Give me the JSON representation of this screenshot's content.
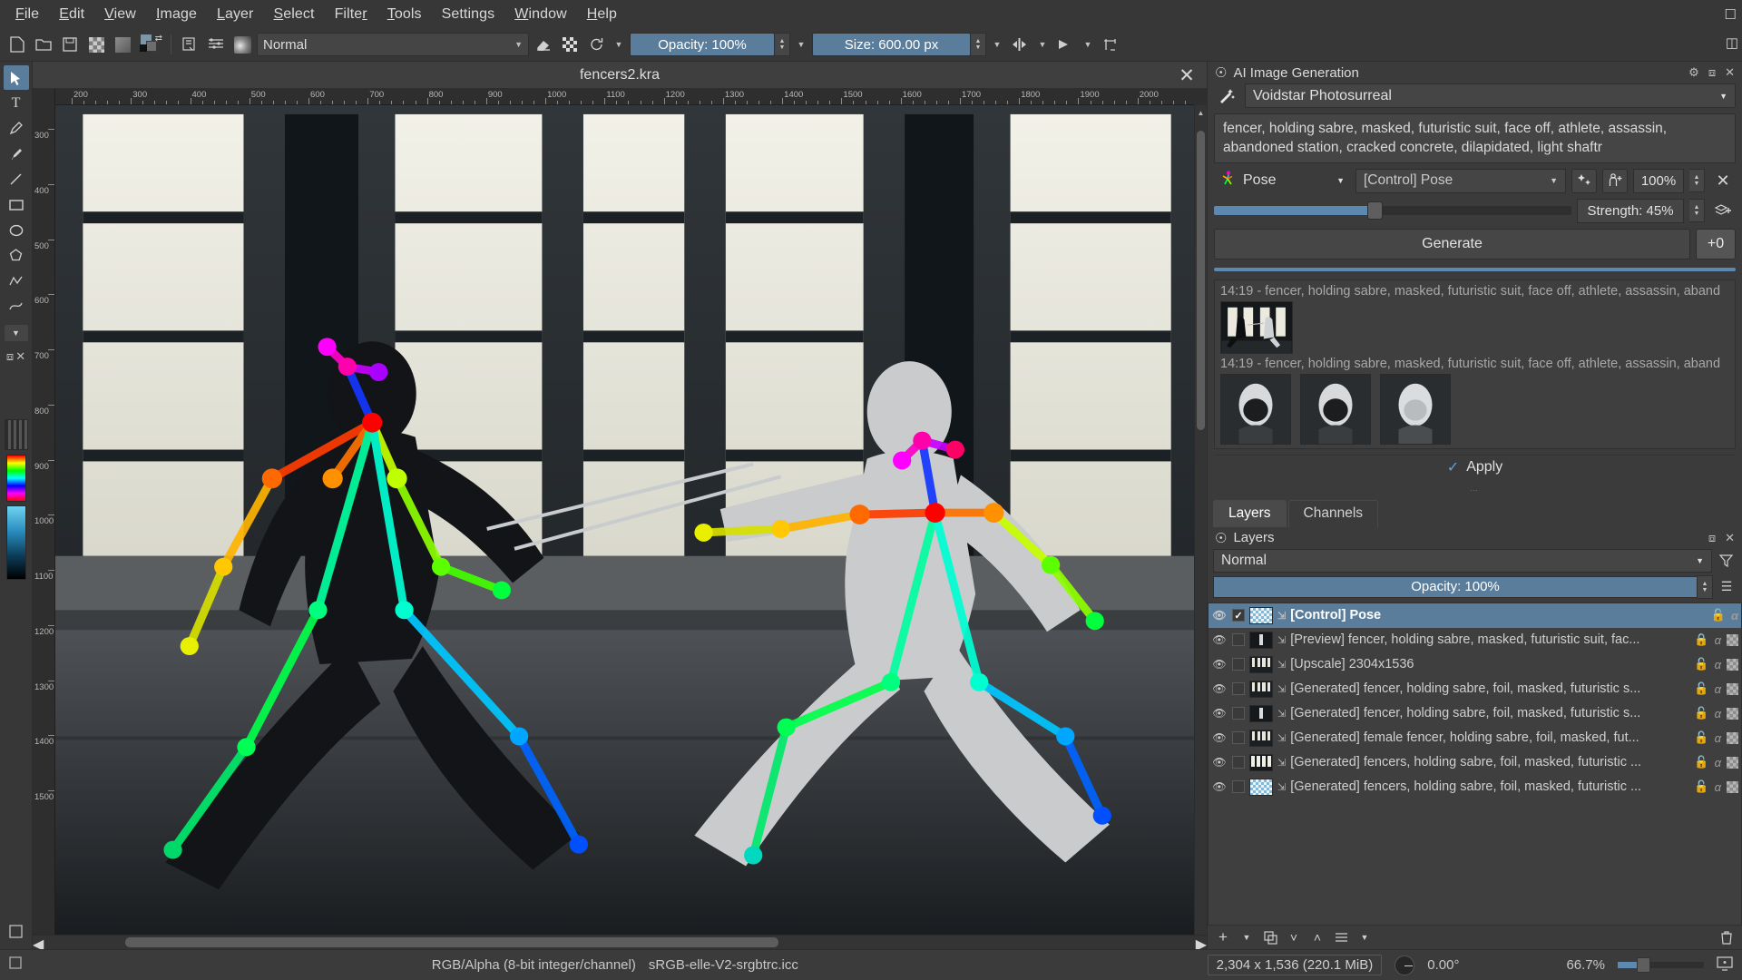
{
  "app": {
    "title": "fencers2.kra"
  },
  "menubar": {
    "items": [
      {
        "label": "File"
      },
      {
        "label": "Edit"
      },
      {
        "label": "View"
      },
      {
        "label": "Image"
      },
      {
        "label": "Layer"
      },
      {
        "label": "Select"
      },
      {
        "label": "Filter"
      },
      {
        "label": "Tools"
      },
      {
        "label": "Settings"
      },
      {
        "label": "Window"
      },
      {
        "label": "Help"
      }
    ]
  },
  "toolbar": {
    "blend_mode": "Normal",
    "opacity_label": "Opacity: 100%",
    "size_label": "Size: 600.00 px",
    "icons": [
      "new-document-icon",
      "open-document-icon",
      "save-icon",
      "transparency-checker-icon",
      "gradient-swatch-icon",
      "fg-bg-color-icon",
      "edit-brush-settings-icon",
      "choose-brush-preset-icon",
      "brush-preset-icon",
      "eraser-icon",
      "preserve-alpha-icon",
      "reload-preset-icon",
      "mirror-horizontal-icon",
      "mirror-vertical-icon",
      "wrap-around-icon"
    ]
  },
  "toolbox": {
    "tools": [
      {
        "name": "select-shapes-tool",
        "glyph": "↖"
      },
      {
        "name": "text-tool",
        "glyph": "T"
      },
      {
        "name": "edit-shapes-tool",
        "glyph": "✎"
      },
      {
        "name": "freehand-brush-tool",
        "glyph": "✒"
      },
      {
        "name": "line-tool",
        "glyph": "╱"
      },
      {
        "name": "rectangle-tool",
        "glyph": "▭"
      },
      {
        "name": "ellipse-tool",
        "glyph": "◯"
      },
      {
        "name": "polygon-tool",
        "glyph": "⬠"
      },
      {
        "name": "polyline-tool",
        "glyph": "⟋"
      },
      {
        "name": "bezier-curve-tool",
        "glyph": "≀"
      },
      {
        "name": "more-tools-chevron",
        "glyph": "▾"
      }
    ]
  },
  "canvas": {
    "hruler_ticks": [
      "200",
      "300",
      "400",
      "500",
      "600",
      "700",
      "800",
      "900",
      "1000",
      "1100",
      "1200",
      "1300",
      "1400",
      "1500",
      "1600",
      "1700",
      "1800",
      "1900",
      "2000"
    ],
    "vruler_ticks": [
      "300",
      "400",
      "500",
      "600",
      "700",
      "800",
      "900",
      "1000",
      "1100",
      "1200",
      "1300",
      "1400",
      "1500"
    ]
  },
  "ai_panel": {
    "dock_title": "AI Image Generation",
    "style": "Voidstar Photosurreal",
    "prompt": "fencer, holding sabre, masked, futuristic suit, face off, athlete, assassin, abandoned station, cracked concrete, dilapidated, light shaftr",
    "control": {
      "type": "Pose",
      "layer": "[Control] Pose",
      "percent": "100%",
      "strength_label": "Strength: 45%",
      "strength_value": 45,
      "buttons": [
        "generate-control-icon",
        "add-person-icon",
        "remove-control-icon",
        "add-control-layer-icon"
      ]
    },
    "generate_label": "Generate",
    "batch_label": "+0",
    "history": [
      {
        "time_prompt": "14:19 - fencer, holding sabre, masked, futuristic suit, face off, athlete, assassin, aband"
      },
      {
        "time_prompt": "14:19 - fencer, holding sabre, masked, futuristic suit, face off, athlete, assassin, aband"
      }
    ],
    "apply_label": "Apply"
  },
  "layers_dock": {
    "tabs": [
      {
        "label": "Layers",
        "active": true
      },
      {
        "label": "Channels",
        "active": false
      }
    ],
    "title": "Layers",
    "blend_mode": "Normal",
    "opacity_label": "Opacity:  100%",
    "rows": [
      {
        "name": "[Control] Pose",
        "visible": true,
        "checked": true,
        "selected": true,
        "locked": false,
        "alpha": true,
        "thumb": "checker"
      },
      {
        "name": "[Preview] fencer, holding sabre, masked, futuristic suit, fac...",
        "visible": true,
        "checked": false,
        "selected": false,
        "locked": true,
        "alpha": true,
        "thumb": "figure"
      },
      {
        "name": "[Upscale] 2304x1536",
        "visible": true,
        "checked": false,
        "selected": false,
        "locked": false,
        "alpha": true,
        "thumb": "scene"
      },
      {
        "name": "[Generated] fencer, holding sabre, foil, masked, futuristic s...",
        "visible": true,
        "checked": false,
        "selected": false,
        "locked": false,
        "alpha": true,
        "thumb": "scene"
      },
      {
        "name": "[Generated] fencer, holding sabre, foil, masked, futuristic s...",
        "visible": true,
        "checked": false,
        "selected": false,
        "locked": false,
        "alpha": true,
        "thumb": "figure"
      },
      {
        "name": "[Generated] female fencer, holding sabre, foil, masked, fut...",
        "visible": true,
        "checked": false,
        "selected": false,
        "locked": false,
        "alpha": true,
        "thumb": "scene"
      },
      {
        "name": "[Generated] fencers, holding sabre, foil, masked, futuristic ...",
        "visible": true,
        "checked": false,
        "selected": false,
        "locked": false,
        "alpha": true,
        "thumb": "bars"
      },
      {
        "name": "[Generated] fencers, holding sabre, foil, masked, futuristic ...",
        "visible": true,
        "checked": false,
        "selected": false,
        "locked": false,
        "alpha": true,
        "thumb": "checker"
      }
    ],
    "toolbar_icons": [
      "add-layer-icon",
      "add-layer-dropdown-icon",
      "duplicate-layer-icon",
      "move-layer-down-icon",
      "move-layer-up-icon",
      "layer-properties-icon",
      "delete-layer-icon"
    ]
  },
  "statusbar": {
    "color_model": "RGB/Alpha (8-bit integer/channel)",
    "color_profile": "sRGB-elle-V2-srgbtrc.icc",
    "dimensions": "2,304 x 1,536 (220.1 MiB)",
    "rotation": "0.00°",
    "zoom": "66.7%"
  },
  "colors": {
    "accent": "#5a7d9c",
    "panel_bg": "#3b3b3b",
    "dark_bg": "#2e2e2e",
    "field_bg": "#454545"
  }
}
